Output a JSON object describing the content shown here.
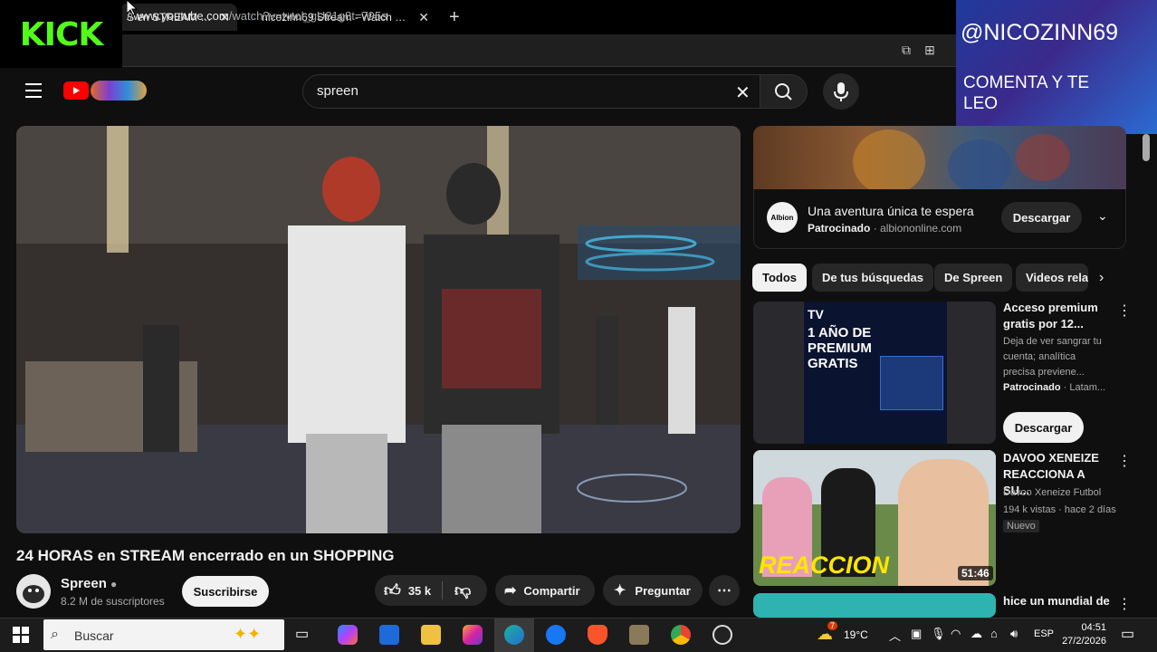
{
  "overlay_kick": {
    "logo": "KICK"
  },
  "overlay_stream": {
    "handle": "@NICOZINN69",
    "message": "COMENTA Y TE LEO"
  },
  "browser": {
    "tabs": [
      {
        "title": "S en STREAM encerr",
        "active": true
      },
      {
        "title": "nicozinn69 Stream - Watch Live or",
        "active": false
      }
    ],
    "url_prefix": "//",
    "url_host": "www.youtube.com",
    "url_path": "/watch?v=tvtol_gU81g8t=795s"
  },
  "youtube": {
    "search_value": "spreen",
    "video": {
      "title": "24 HORAS en STREAM encerrado en un SHOPPING",
      "channel": "Spreen",
      "subscribers": "8.2 M de suscriptores",
      "subscribe_label": "Suscribirse",
      "likes": "35 k",
      "share_label": "Compartir",
      "ask_label": "Preguntar"
    },
    "ad": {
      "logo": "Albion",
      "title": "Una aventura única te espera",
      "sponsored": "Patrocinado",
      "domain": "albiononline.com",
      "cta": "Descargar"
    },
    "chips": [
      "Todos",
      "De tus búsquedas",
      "De Spreen",
      "Videos rela"
    ],
    "recommendations": [
      {
        "title": "Acceso premium gratis por 12...",
        "description": "Deja de ver sangrar tu cuenta; analítica precisa previene...",
        "sponsored": "Patrocinado",
        "sponsor_suffix": "Latam...",
        "cta": "Descargar",
        "thumb_text_1": "1 AÑO DE",
        "thumb_text_2": "PREMIUM",
        "thumb_text_3": "GRATIS",
        "thumb_logo": "TV"
      },
      {
        "title": "DAVOO XENEIZE REACCIONA A SU...",
        "channel": "Davoo Xeneize Futbol",
        "meta": "194 k vistas · hace 2 días",
        "badge": "Nuevo",
        "duration": "51:46",
        "thumb_text": "REACCION"
      },
      {
        "title": "hice un mundial de"
      }
    ]
  },
  "taskbar": {
    "search_placeholder": "Buscar",
    "weather": "19°C",
    "weather_badge": "7",
    "language": "ESP",
    "time": "04:51",
    "date": "27/2/2026"
  }
}
